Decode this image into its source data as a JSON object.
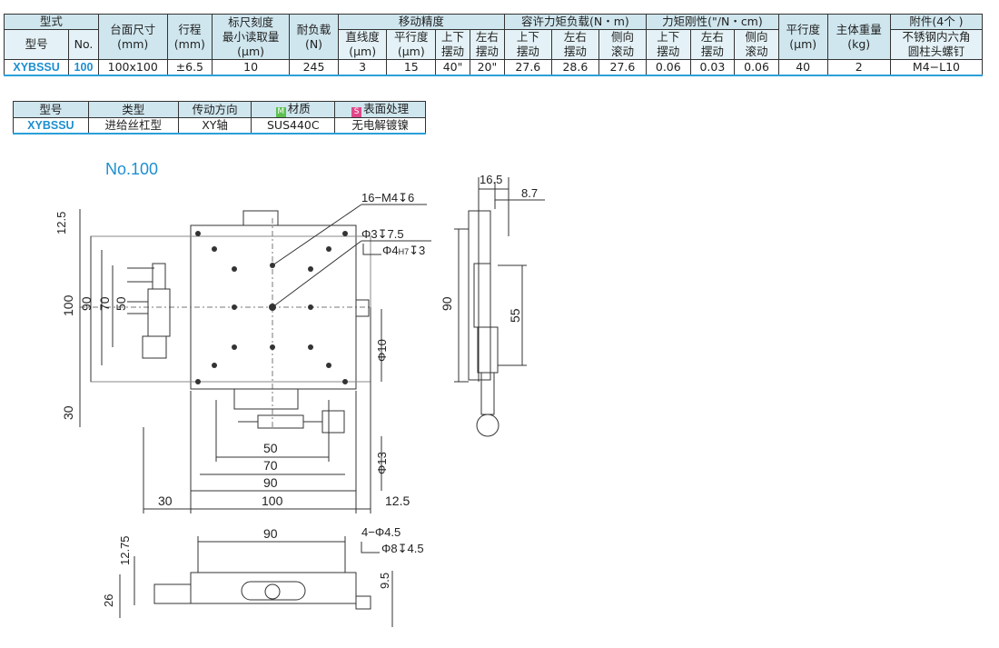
{
  "spec_table": {
    "h_type": "型式",
    "h_model": "型号",
    "h_no": "No.",
    "h_table_size": "台面尺寸",
    "h_table_size_unit": "(mm)",
    "h_stroke": "行程",
    "h_stroke_unit": "(mm)",
    "h_scale": "标尺刻度",
    "h_min_read": "最小读取量",
    "h_min_read_unit": "(μm)",
    "h_load": "耐负载",
    "h_load_unit": "(N)",
    "h_accuracy": "移动精度",
    "h_straight": "直线度",
    "h_straight_unit": "(μm)",
    "h_parallel": "平行度",
    "h_parallel_unit": "(μm)",
    "h_pitch": "上下",
    "h_pitch2": "摆动",
    "h_yaw": "左右",
    "h_yaw2": "摆动",
    "h_moment": "容许力矩负载(N・m)",
    "h_m_pitch": "上下",
    "h_m_pitch2": "摆动",
    "h_m_yaw": "左右",
    "h_m_yaw2": "摆动",
    "h_m_roll": "侧向",
    "h_m_roll2": "滚动",
    "h_rigid": "力矩刚性(\"/N・cm)",
    "h_r_pitch": "上下",
    "h_r_pitch2": "摆动",
    "h_r_yaw": "左右",
    "h_r_yaw2": "摆动",
    "h_r_roll": "侧向",
    "h_r_roll2": "滚动",
    "h_flat": "平行度",
    "h_flat_unit": "(μm)",
    "h_weight": "主体重量",
    "h_weight_unit": "(kg)",
    "h_acc": "附件(4个 )",
    "h_acc2": "不锈钢内六角",
    "h_acc3": "圆柱头螺钉",
    "row": {
      "model": "XYBSSU",
      "no": "100",
      "size": "100x100",
      "stroke": "±6.5",
      "min_read": "10",
      "load": "245",
      "straight": "3",
      "parallel": "15",
      "pitch": "40\"",
      "yaw": "20\"",
      "m_pitch": "27.6",
      "m_yaw": "28.6",
      "m_roll": "27.6",
      "r_pitch": "0.06",
      "r_yaw": "0.03",
      "r_roll": "0.06",
      "flat": "40",
      "weight": "2",
      "acc": "M4−L10"
    }
  },
  "material_table": {
    "h_model": "型号",
    "h_type": "类型",
    "h_drive": "传动方向",
    "h_material_icon": "M",
    "h_material": "材质",
    "h_surface_icon": "S",
    "h_surface": "表面处理",
    "row": {
      "model": "XYBSSU",
      "type": "进给丝杠型",
      "drive": "XY轴",
      "material": "SUS440C",
      "surface": "无电解镀镍"
    }
  },
  "drawing": {
    "title": "No.100",
    "top_view": {
      "dim_12_5_top": "12.5",
      "dim_100_v": "100",
      "dim_90_v": "90",
      "dim_70_v": "70",
      "dim_50_v": "50",
      "dim_30_v": "30",
      "dim_50_h": "50",
      "dim_70_h": "70",
      "dim_90_h": "90",
      "dim_30_h": "30",
      "dim_100_h": "100",
      "dim_12_5_h": "12.5",
      "phi10": "Φ10",
      "phi13": "Φ13",
      "note_tapped": "16−M4",
      "note_tapped_depth": "6",
      "note_pin_hole": "Φ3",
      "note_pin_depth": "7.5",
      "note_pin_hole2": "Φ4",
      "note_pin_fit": "H7",
      "note_pin_depth2": "3"
    },
    "side_view": {
      "dim_16_5": "16.5",
      "dim_8_7": "8.7",
      "dim_90": "90",
      "dim_55": "55"
    },
    "front_view": {
      "dim_90": "90",
      "note_holes": "4−Φ4.5",
      "note_cb": "Φ8",
      "note_cb_depth": "4.5",
      "dim_12_75": "12.75",
      "dim_26": "26",
      "dim_9_5": "9.5"
    }
  }
}
